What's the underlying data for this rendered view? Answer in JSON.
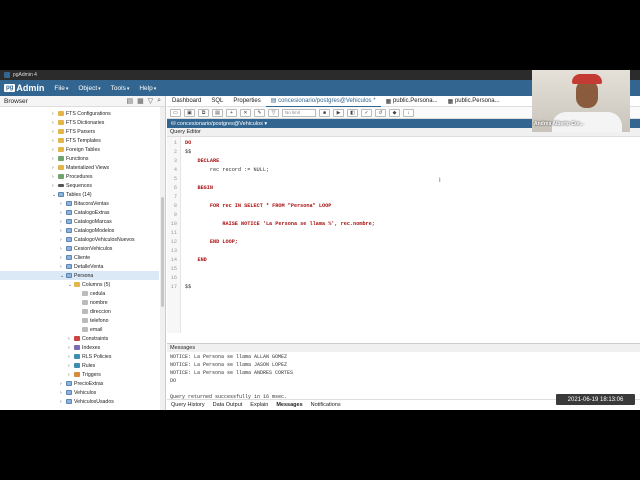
{
  "app": {
    "title": "pgAdmin 4",
    "brand_pg": "pg",
    "brand_admin": "Admin"
  },
  "menu": [
    {
      "label": "File"
    },
    {
      "label": "Object"
    },
    {
      "label": "Tools"
    },
    {
      "label": "Help"
    }
  ],
  "browser": {
    "title": "Browser",
    "rows": [
      {
        "label": "FTS Configurations",
        "icon": "folder-icon"
      },
      {
        "label": "FTS Dictionaries",
        "icon": "folder-icon"
      },
      {
        "label": "FTS Parsers",
        "icon": "folder-icon"
      },
      {
        "label": "FTS Templates",
        "icon": "folder-icon"
      },
      {
        "label": "Foreign Tables",
        "icon": "folder-icon"
      },
      {
        "label": "Functions",
        "icon": "function-icon"
      },
      {
        "label": "Materialized Views",
        "icon": "folder-icon"
      },
      {
        "label": "Procedures",
        "icon": "function-icon"
      },
      {
        "label": "Sequences",
        "icon": "sequence-icon"
      },
      {
        "label": "Tables (14)",
        "icon": "table-icon"
      },
      {
        "label": "BitacoraVentas",
        "icon": "table-icon"
      },
      {
        "label": "CatalogoExtras",
        "icon": "table-icon"
      },
      {
        "label": "CatalogoMarcas",
        "icon": "table-icon"
      },
      {
        "label": "CatalogoModelos",
        "icon": "table-icon"
      },
      {
        "label": "CatalogoVehiculosNuevos",
        "icon": "table-icon"
      },
      {
        "label": "CesionVehiculos",
        "icon": "table-icon"
      },
      {
        "label": "Cliente",
        "icon": "table-icon"
      },
      {
        "label": "DetalleVenta",
        "icon": "table-icon"
      },
      {
        "label": "Persona",
        "icon": "table-icon"
      },
      {
        "label": "Columns (5)",
        "icon": "folder-icon"
      },
      {
        "label": "cedula",
        "icon": "column-icon"
      },
      {
        "label": "nombre",
        "icon": "column-icon"
      },
      {
        "label": "direccion",
        "icon": "column-icon"
      },
      {
        "label": "telefono",
        "icon": "column-icon"
      },
      {
        "label": "email",
        "icon": "column-icon"
      },
      {
        "label": "Constraints",
        "icon": "constraint-icon"
      },
      {
        "label": "Indexes",
        "icon": "index-icon"
      },
      {
        "label": "RLS Policies",
        "icon": "rule-icon"
      },
      {
        "label": "Rules",
        "icon": "rule-icon"
      },
      {
        "label": "Triggers",
        "icon": "trigger-icon"
      },
      {
        "label": "PrecioExtras",
        "icon": "table-icon"
      },
      {
        "label": "Vehiculos",
        "icon": "table-icon"
      },
      {
        "label": "VehiculosUsados",
        "icon": "table-icon"
      }
    ]
  },
  "tabs": [
    {
      "label": "Dashboard"
    },
    {
      "label": "SQL"
    },
    {
      "label": "Properties"
    },
    {
      "label": "concesionario/postgres@Vehiculos *"
    },
    {
      "label": "public.Persona..."
    },
    {
      "label": "public.Persona..."
    }
  ],
  "toolbar": {
    "limit_label": "No limit"
  },
  "connection": {
    "label": "concesionario/postgres@Vehiculos"
  },
  "query_editor": {
    "title": "Query Editor",
    "lines": [
      {
        "n": "1",
        "text": "DO"
      },
      {
        "n": "2",
        "text": "$$"
      },
      {
        "n": "3",
        "text": "    DECLARE"
      },
      {
        "n": "4",
        "text": "        rec record := NULL;"
      },
      {
        "n": "5",
        "text": ""
      },
      {
        "n": "6",
        "text": "    BEGIN"
      },
      {
        "n": "7",
        "text": ""
      },
      {
        "n": "8",
        "text": "        FOR rec IN SELECT * FROM \"Persona\" LOOP"
      },
      {
        "n": "9",
        "text": ""
      },
      {
        "n": "10",
        "text": "            RAISE NOTICE 'La Persona se llama %', rec.nombre;"
      },
      {
        "n": "11",
        "text": ""
      },
      {
        "n": "12",
        "text": "        END LOOP;"
      },
      {
        "n": "13",
        "text": ""
      },
      {
        "n": "14",
        "text": "    END"
      },
      {
        "n": "15",
        "text": ""
      },
      {
        "n": "16",
        "text": ""
      },
      {
        "n": "17",
        "text": "$$"
      }
    ]
  },
  "messages": {
    "title": "Messages",
    "lines": [
      "NOTICE:  La Persona se llama ALLAN GOMEZ",
      "NOTICE:  La Persona se llama JASON LOPEZ",
      "NOTICE:  La Persona se llama ANDRES CORTES",
      "DO",
      "",
      "Query returned successfully in 16 msec."
    ]
  },
  "bottom_tabs": [
    {
      "label": "Query History"
    },
    {
      "label": "Data Output"
    },
    {
      "label": "Explain"
    },
    {
      "label": "Messages"
    },
    {
      "label": "Notifications"
    }
  ],
  "overlay": {
    "timestamp": "2021-06-19  18:13:06",
    "webcam_name": "Andrés Alberto Cor..."
  }
}
